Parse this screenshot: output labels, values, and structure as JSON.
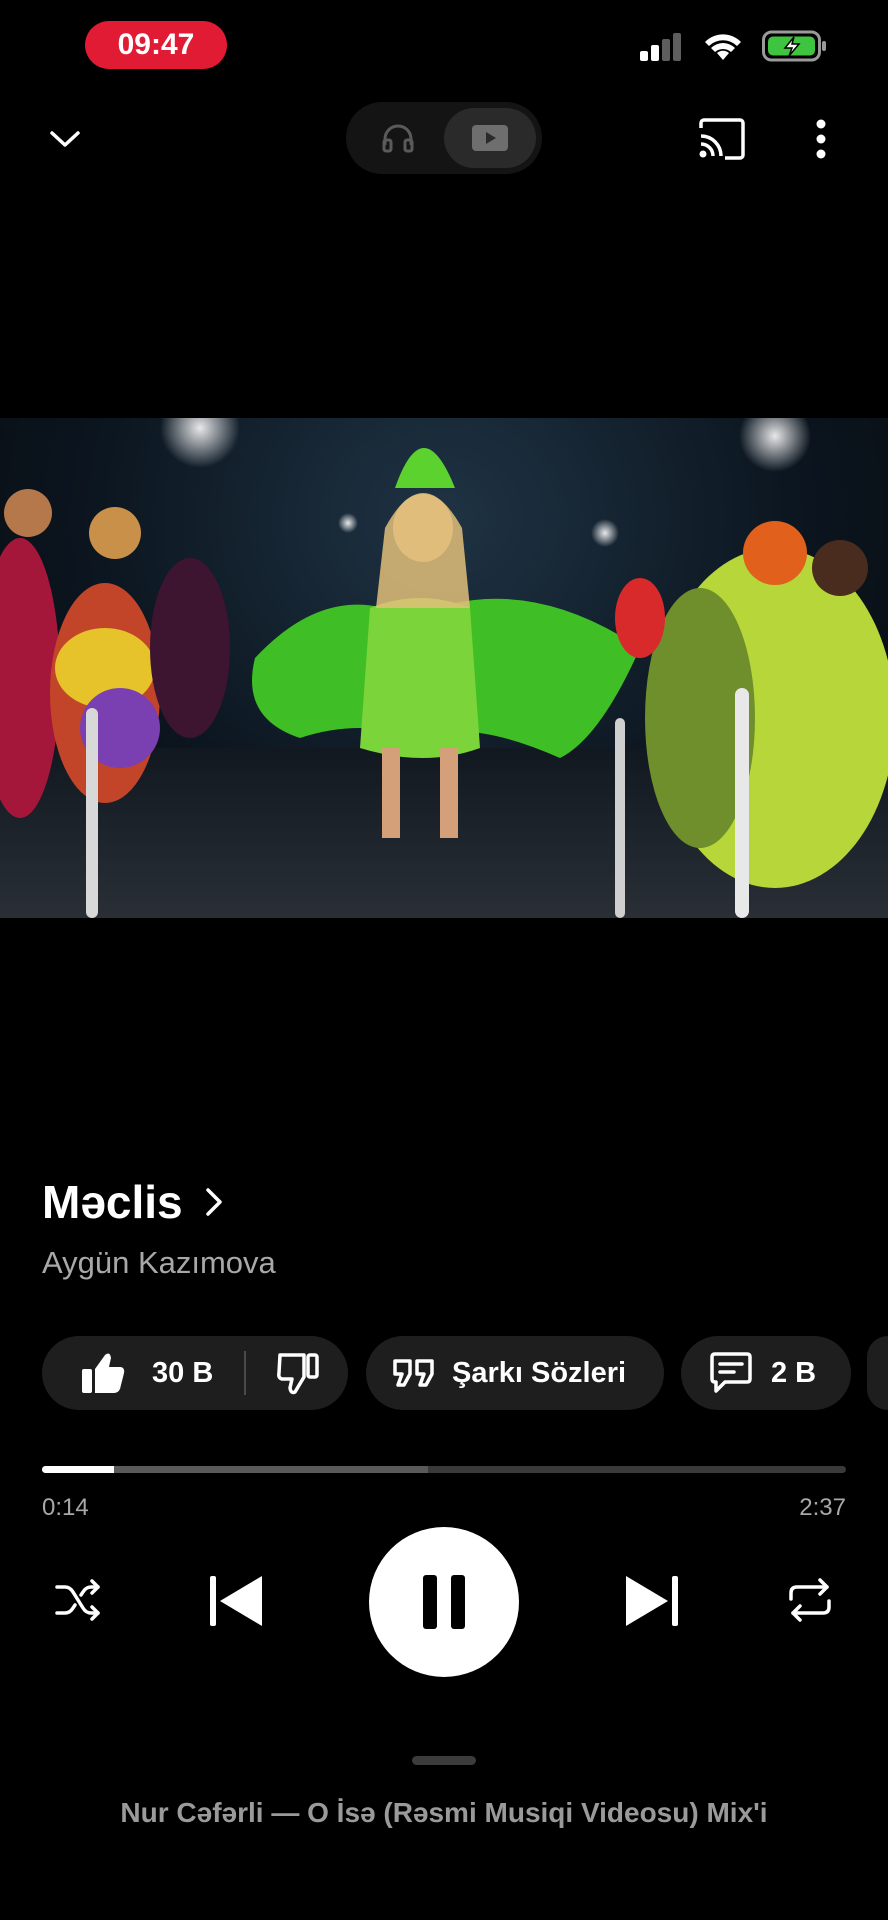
{
  "status_bar": {
    "time": "09:47"
  },
  "song": {
    "title": "Məclis",
    "artist": "Aygün Kazımova"
  },
  "actions": {
    "like_count": "30 B",
    "lyrics_label": "Şarkı Sözleri",
    "comments_count": "2 B"
  },
  "progress": {
    "current": "0:14",
    "total": "2:37",
    "played_fraction": 0.089,
    "buffered_fraction": 0.48
  },
  "up_next": {
    "label": "Nur Cəfərli — O İsə (Rəsmi Musiqi Videosu) Mix'i"
  },
  "colors": {
    "accent_time_pill": "#e01b33",
    "battery_green": "#3ec43e",
    "background": "#000000"
  }
}
